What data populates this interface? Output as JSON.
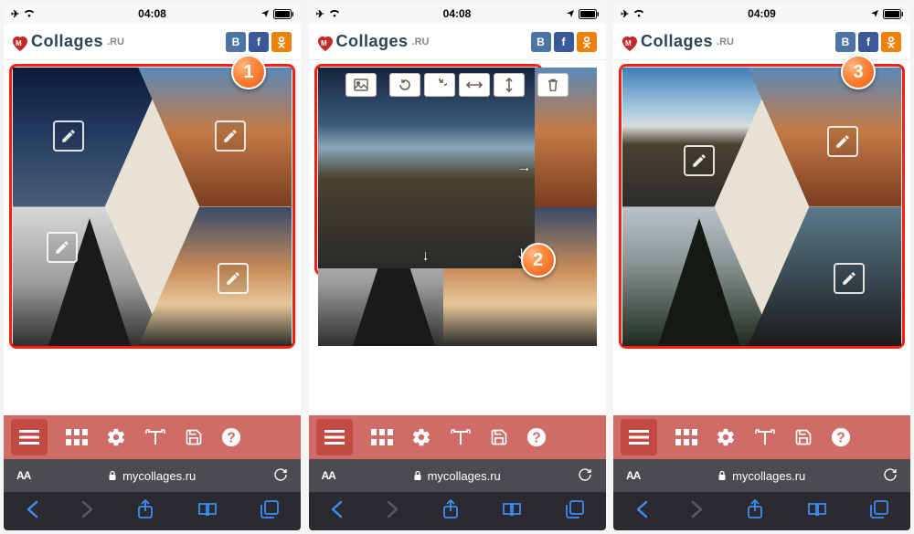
{
  "status": {
    "time1": "04:08",
    "time2": "04:08",
    "time3": "04:09"
  },
  "logo": {
    "text": "Collages",
    "suffix": ".RU"
  },
  "social": {
    "vk": "B",
    "fb": "f",
    "ok": ""
  },
  "url": "mycollages.ru",
  "aa": "AA",
  "callouts": {
    "c1": "1",
    "c2": "2",
    "c3": "3"
  },
  "toolbar": {
    "menu": "menu",
    "grid": "grid",
    "settings": "settings",
    "text": "text",
    "save": "save",
    "help": "help"
  },
  "img_toolbar": {
    "replace": "replace-image",
    "undo": "rotate-ccw",
    "redo": "rotate-cw",
    "fliph": "flip-horizontal",
    "flipv": "flip-vertical",
    "delete": "delete"
  }
}
